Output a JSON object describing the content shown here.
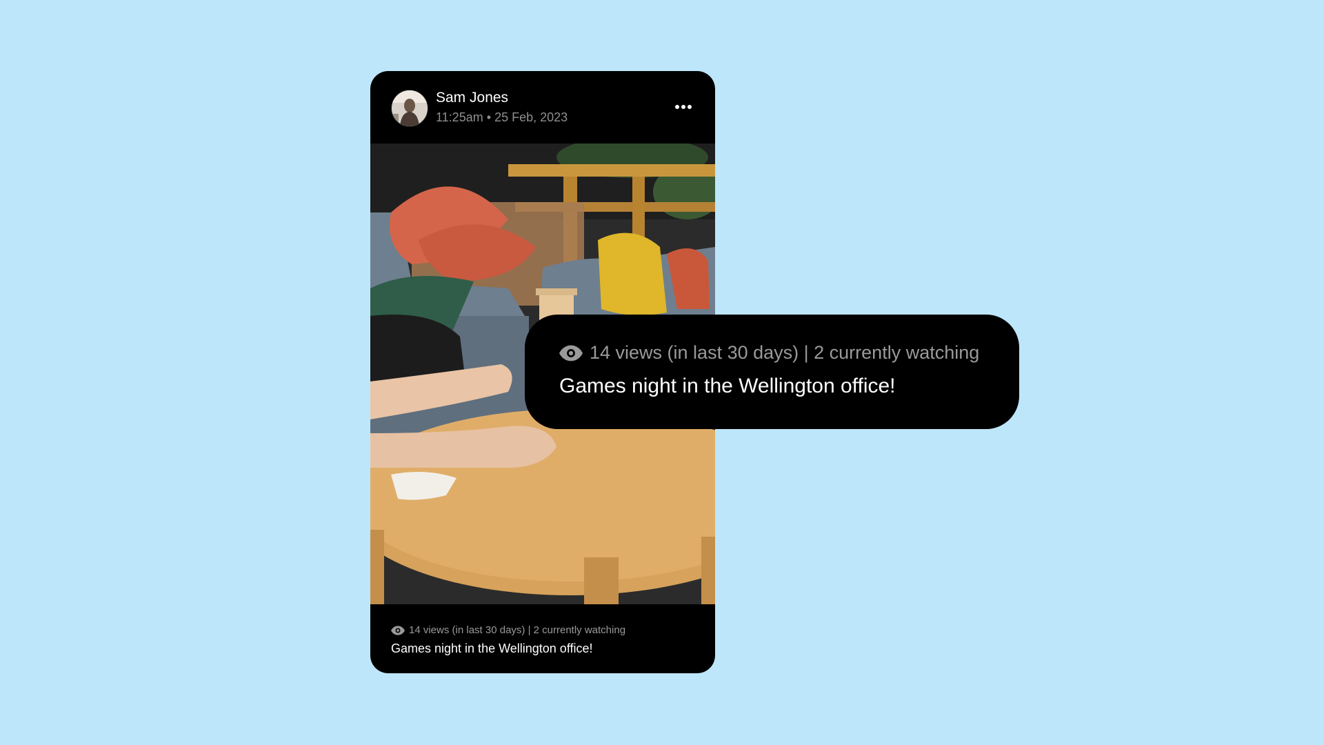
{
  "post": {
    "author": "Sam Jones",
    "time": "11:25am",
    "separator": "•",
    "date": "25 Feb, 2023",
    "stats": "14 views (in last 30 days) | 2 currently watching",
    "caption": "Games night in the Wellington office!"
  },
  "callout": {
    "stats": "14 views (in last 30 days) | 2 currently watching",
    "caption": "Games night in the Wellington office!"
  },
  "icons": {
    "menu": "more-horizontal-icon",
    "views": "eye-icon"
  },
  "colors": {
    "background": "#BEE6FB",
    "card": "#000000",
    "muted_text": "#9A9A9A",
    "text": "#FFFFFF"
  }
}
